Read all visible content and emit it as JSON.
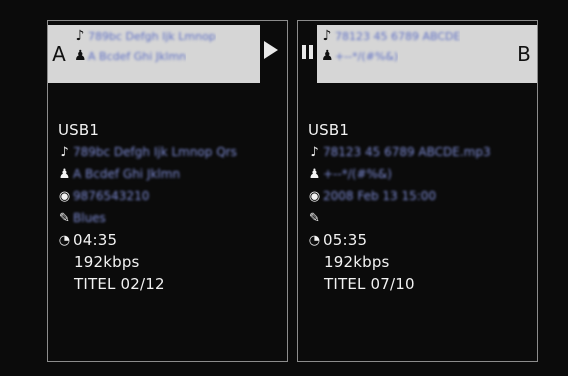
{
  "deck_a": {
    "label": "A",
    "header": {
      "title": "789bc Defgh Ijk Lmnop",
      "artist": "A Bcdef Ghi Jklmn"
    },
    "status_icon": "play-icon",
    "source": "USB1",
    "title": "789bc Defgh Ijk Lmnop Qrs",
    "artist": "A Bcdef Ghi Jklmn",
    "code": "9876543210",
    "genre": "Blues",
    "time": "04:35",
    "bitrate": "192kbps",
    "track": "TITEL 02/12"
  },
  "deck_b": {
    "label": "B",
    "header": {
      "title": "78123 45 6789 ABCDE",
      "artist": "+--*/(#%&)"
    },
    "status_icon": "pause-icon",
    "source": "USB1",
    "title": "78123 45 6789 ABCDE.mp3",
    "artist": "+--*/(#%&)",
    "date": "2008 Feb 13 15:00",
    "genre": "",
    "time": "05:35",
    "bitrate": "192kbps",
    "track": "TITEL 07/10"
  },
  "colors": {
    "background": "#0b0b0b",
    "header_bg": "#d6d6d6",
    "border": "#8c8c8c",
    "text": "#f2f2f2",
    "blurred_text": "#7d8bd4"
  }
}
